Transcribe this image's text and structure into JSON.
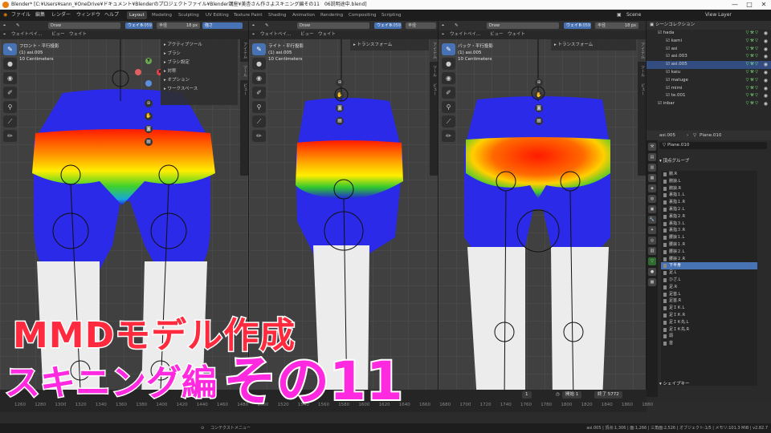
{
  "window": {
    "title": "Blender* [C:¥Users¥sann_¥OneDrive¥ドキュメント¥Blenderのプロジェクトファイル¥Blender講座¥美杏さん作さよスキニング編その11　06説明途中.blend]",
    "min": "—",
    "max": "□",
    "close": "✕"
  },
  "menubar": {
    "items": [
      "ファイル",
      "編集",
      "レンダー",
      "ウィンドウ",
      "ヘルプ"
    ],
    "workspaces": [
      "Layout",
      "Modeling",
      "Sculpting",
      "UV Editing",
      "Texture Paint",
      "Shading",
      "Animation",
      "Rendering",
      "Compositing",
      "Scripting"
    ],
    "active_workspace": "Layout",
    "scene": "Scene",
    "view_layer": "View Layer"
  },
  "viewports": [
    {
      "header": {
        "mode": "ウェイトペイ...",
        "menus": [
          "ビュー",
          "ウェイト"
        ],
        "brush": "Draw",
        "weight_label": "ウェイト",
        "weight": "0.059",
        "radius_label": "半径",
        "radius": "18 px",
        "strength_label": "強さ",
        "strength": "1.000"
      },
      "info": {
        "view": "フロント・平行投影",
        "object": "(1) asi.005",
        "scale": "10 Centimeters"
      },
      "sidebar_menu": [
        "アクティブツール",
        "ブラシ",
        "ブラシ設定",
        "対称",
        "オプション",
        "ワークスペース"
      ],
      "side_tabs": [
        "アイテム",
        "ツール",
        "ビュー"
      ]
    },
    {
      "header": {
        "mode": "ウェイトペイ...",
        "menus": [
          "ビュー",
          "ウェイト"
        ],
        "brush": "Draw",
        "weight_label": "ウェイト",
        "weight": "0.059",
        "radius_label": "半径",
        "radius": "18 px"
      },
      "info": {
        "view": "ライト・平行投影",
        "object": "(1) asi.005",
        "scale": "10 Centimeters"
      },
      "sidebar_menu": [
        "トランスフォーム"
      ],
      "side_tabs": [
        "アイテム",
        "ツール",
        "ビュー"
      ]
    },
    {
      "header": {
        "mode": "ウェイトペイ...",
        "menus": [
          "ビュー",
          "ウェイト"
        ],
        "brush": "Draw",
        "weight_label": "ウェイト",
        "weight": "0.059",
        "radius_label": "半径",
        "radius": "18 px"
      },
      "info": {
        "view": "バック・平行投影",
        "object": "(1) asi.005",
        "scale": "10 Centimeters"
      },
      "sidebar_menu": [
        "トランスフォーム"
      ],
      "side_tabs": [
        "アイテム",
        "ツール",
        "ビュー"
      ]
    }
  ],
  "outliner": {
    "title": "シーンコレクション",
    "rows": [
      {
        "label": "hada",
        "indent": 1
      },
      {
        "label": "kami",
        "indent": 2
      },
      {
        "label": "asi",
        "indent": 2
      },
      {
        "label": "asi.003",
        "indent": 2
      },
      {
        "label": "asi.005",
        "indent": 2,
        "selected": true
      },
      {
        "label": "kaiu",
        "indent": 2
      },
      {
        "label": "matuge",
        "indent": 2
      },
      {
        "label": "mimi",
        "indent": 2
      },
      {
        "label": "te.001",
        "indent": 2
      },
      {
        "label": "inbar",
        "indent": 1
      }
    ]
  },
  "properties": {
    "object": "asi.005",
    "mesh": "Plane.010",
    "mesh_field": "Plane.010",
    "section_vgroups": "頂点グループ",
    "section_shapekeys": "シェイプキー",
    "vertex_groups": [
      "腕.R",
      "腕捩.L",
      "腕捩.R",
      "裏指１.L",
      "裏指１.R",
      "裏指２.L",
      "裏指２.R",
      "裏指３.L",
      "裏指３.R",
      "腰捩１.L",
      "腰捩１.R",
      "腰捩２.L",
      "腰捩２.R",
      "下半身",
      "足.L",
      "ひざ.L",
      "足.R",
      "足首.L",
      "足首.R",
      "足ＩＫ.L",
      "足ＩＫ.R",
      "足ＩＫ先.L",
      "足ＩＫ先.R",
      "頭",
      "首"
    ],
    "selected_group": "下半身"
  },
  "timeline": {
    "frame": "1",
    "start_label": "開始",
    "start": "1",
    "end_label": "終了",
    "end": "5772",
    "ticks": [
      "1260",
      "1280",
      "1300",
      "1320",
      "1340",
      "1360",
      "1380",
      "1400",
      "1420",
      "1440",
      "1460",
      "1480",
      "1500",
      "1520",
      "1540",
      "1560",
      "1580",
      "1600",
      "1620",
      "1640",
      "1660",
      "1680",
      "1700",
      "1720",
      "1740",
      "1760",
      "1780",
      "1800",
      "1820",
      "1840",
      "1860",
      "1880"
    ]
  },
  "statusbar": {
    "left": "コンテクストメニュー",
    "right": "asi.005 | 頂点:1,306 | 面:1,266 | 三角面:2,526 | オブジェクト:1/5 | メモリ:101.3 MiB | v2.82.7"
  },
  "overlay": {
    "line1": "MMDモデル作成",
    "line2": "スキニング編",
    "line3": "その11"
  },
  "colors": {
    "overlay_red": "#ff2a3e",
    "overlay_pink": "#ff2ae0",
    "accent": "#4772b3"
  }
}
